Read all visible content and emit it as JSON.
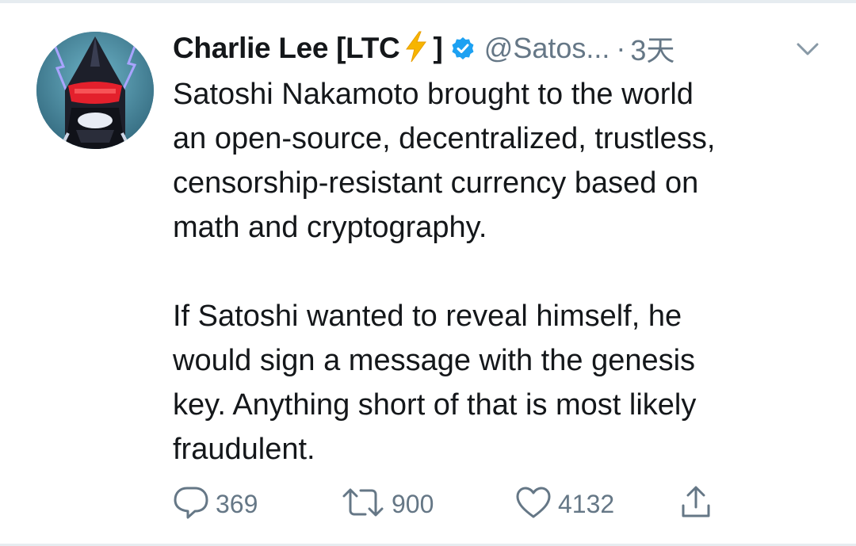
{
  "tweet": {
    "author_name": "Charlie Lee [LTC",
    "author_name_close": "]",
    "handle": "@Satos...",
    "separator": "·",
    "time": "3天",
    "lightning_emoji": "lightning-bolt-emoji",
    "paragraph_1": "Satoshi Nakamoto brought to the world\nan open-source, decentralized, trustless,\ncensorship-resistant currency based on\nmath and cryptography.",
    "paragraph_2": "If Satoshi wanted to reveal himself, he\nwould sign a message with the genesis\nkey. Anything short of that is most likely\nfraudulent."
  },
  "actions": {
    "reply_count": "369",
    "retweet_count": "900",
    "like_count": "4132"
  },
  "icons": {
    "verified": "verified-badge-icon",
    "caret": "chevron-down-icon",
    "reply": "reply-icon",
    "retweet": "retweet-icon",
    "like": "heart-icon",
    "share": "share-icon"
  },
  "colors": {
    "verified": "#1da1f2",
    "secondary_text": "#657786",
    "primary_text": "#14171a",
    "bolt": "#f7b500"
  }
}
